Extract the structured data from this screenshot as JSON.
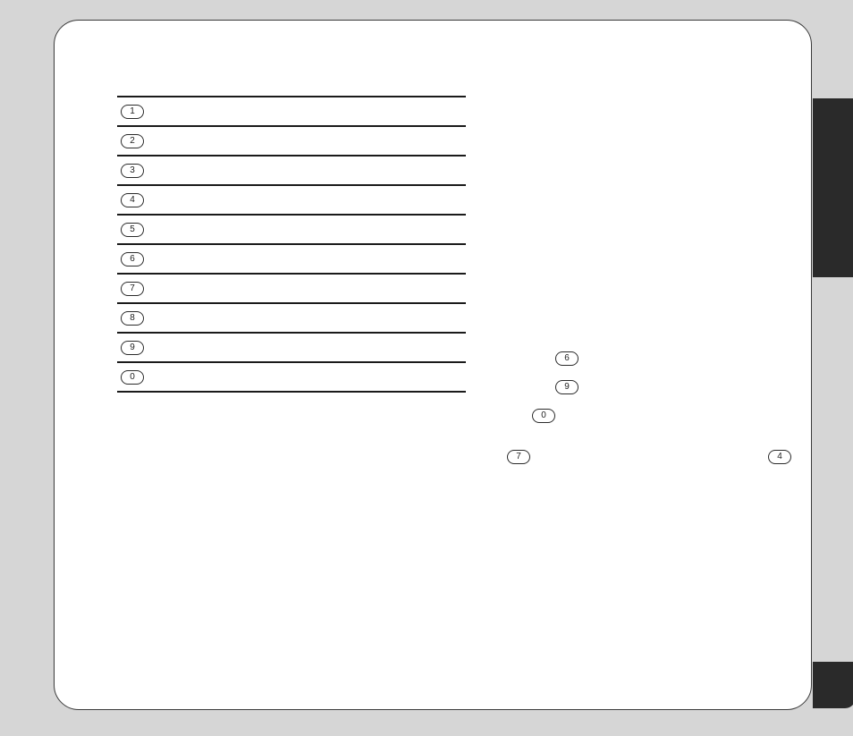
{
  "list": {
    "items": [
      {
        "num": "1"
      },
      {
        "num": "2"
      },
      {
        "num": "3"
      },
      {
        "num": "4"
      },
      {
        "num": "5"
      },
      {
        "num": "6"
      },
      {
        "num": "7"
      },
      {
        "num": "8"
      },
      {
        "num": "9"
      },
      {
        "num": "0"
      }
    ]
  },
  "floating": {
    "p1": "6",
    "p2": "9",
    "p3": "0",
    "p4": "7",
    "p5": "4"
  }
}
